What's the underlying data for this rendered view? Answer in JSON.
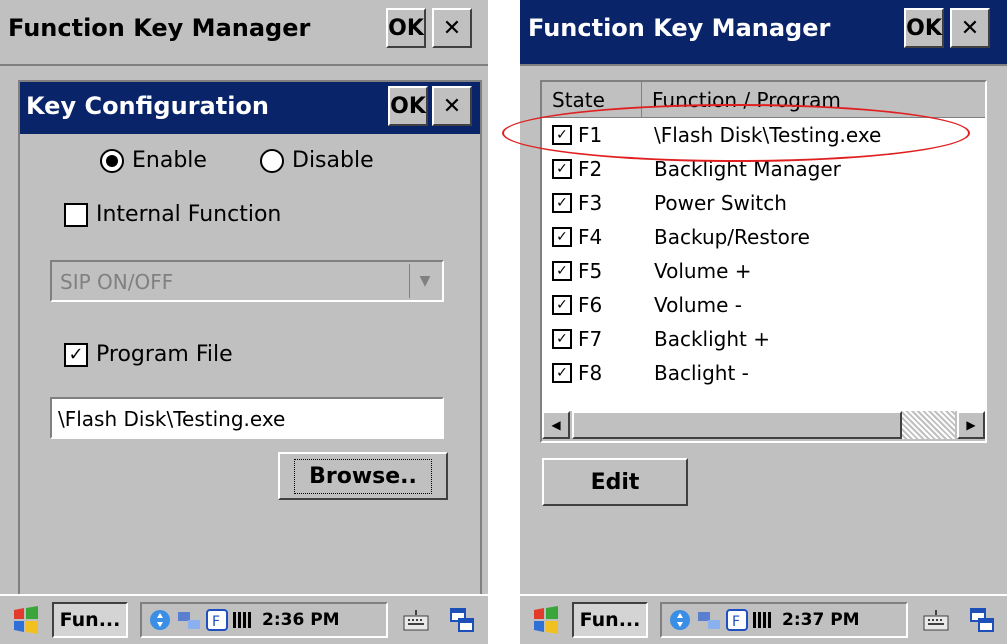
{
  "left": {
    "app_title": "Function Key Manager",
    "ok_label": "OK",
    "close_label": "✕",
    "dialog": {
      "title": "Key Configuration",
      "ok_label": "OK",
      "close_label": "✕",
      "enable_label": "Enable",
      "disable_label": "Disable",
      "selected": "Enable",
      "internal_function_label": "Internal Function",
      "internal_function_checked": false,
      "internal_function_value": "SIP ON/OFF",
      "program_file_label": "Program File",
      "program_file_checked": true,
      "program_path": "\\Flash Disk\\Testing.exe",
      "browse_label": "Browse.."
    },
    "taskbar": {
      "app_label": "Fun...",
      "clock": "2:36 PM"
    }
  },
  "right": {
    "app_title": "Function Key Manager",
    "ok_label": "OK",
    "close_label": "✕",
    "columns": [
      "State",
      "Function / Program"
    ],
    "rows": [
      {
        "key": "F1",
        "function": "\\Flash Disk\\Testing.exe",
        "checked": true
      },
      {
        "key": "F2",
        "function": "Backlight Manager",
        "checked": true
      },
      {
        "key": "F3",
        "function": "Power Switch",
        "checked": true
      },
      {
        "key": "F4",
        "function": "Backup/Restore",
        "checked": true
      },
      {
        "key": "F5",
        "function": "Volume +",
        "checked": true
      },
      {
        "key": "F6",
        "function": "Volume -",
        "checked": true
      },
      {
        "key": "F7",
        "function": "Backlight +",
        "checked": true
      },
      {
        "key": "F8",
        "function": "Baclight -",
        "checked": true
      }
    ],
    "edit_label": "Edit",
    "taskbar": {
      "app_label": "Fun...",
      "clock": "2:37 PM"
    }
  },
  "icons": {
    "start": "windows-flag-icon",
    "tray": [
      "input-panel-icon",
      "network-icon",
      "f-key-icon",
      "battery-icon"
    ],
    "keyboard": "keyboard-icon",
    "desktop": "desktop-icon"
  },
  "colors": {
    "title_active": "#0a246a",
    "window": "#c0c0c0",
    "highlight_ellipse": "#e02020"
  }
}
